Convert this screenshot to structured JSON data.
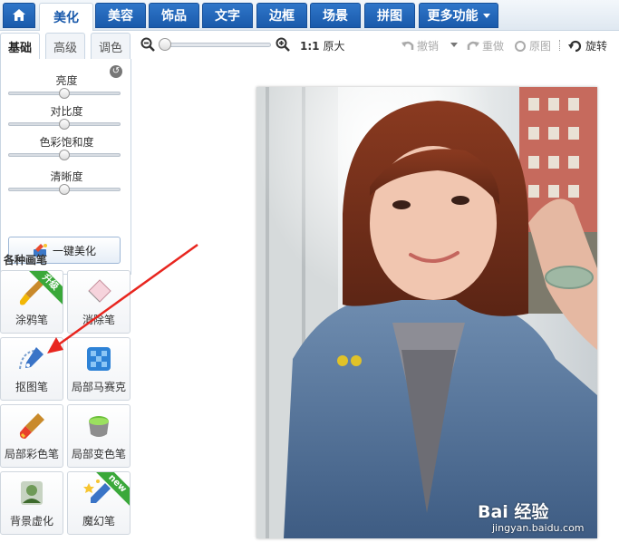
{
  "nav": {
    "tabs": [
      {
        "label": "美化",
        "active": true
      },
      {
        "label": "美容"
      },
      {
        "label": "饰品"
      },
      {
        "label": "文字"
      },
      {
        "label": "边框"
      },
      {
        "label": "场景"
      },
      {
        "label": "拼图"
      },
      {
        "label": "更多功能"
      }
    ]
  },
  "panel": {
    "subtabs": [
      "基础",
      "高级",
      "调色"
    ],
    "sliders": [
      {
        "label": "亮度",
        "value": 0.5
      },
      {
        "label": "对比度",
        "value": 0.5
      },
      {
        "label": "色彩饱和度",
        "value": 0.5
      },
      {
        "label": "清晰度",
        "value": 0.5
      }
    ],
    "onekey_label": "一键美化",
    "section_title": "各种画笔",
    "tools": [
      {
        "label": "涂鸦笔",
        "badge": "升级"
      },
      {
        "label": "消除笔"
      },
      {
        "label": "抠图笔"
      },
      {
        "label": "局部马赛克"
      },
      {
        "label": "局部彩色笔"
      },
      {
        "label": "局部变色笔"
      },
      {
        "label": "背景虚化"
      },
      {
        "label": "魔幻笔",
        "badge": "new"
      }
    ]
  },
  "toolbar": {
    "zoom_value": 0.0,
    "actual_size_label": "原大",
    "actual_size_prefix": "1:1",
    "undo_label": "撤销",
    "redo_label": "重做",
    "original_label": "原图",
    "rotate_label": "旋转"
  },
  "watermark": {
    "main": "Bai 经验",
    "sub": "jingyan.baidu.com"
  },
  "colors": {
    "accent": "#1a5aab",
    "arrow": "#e8261f"
  }
}
